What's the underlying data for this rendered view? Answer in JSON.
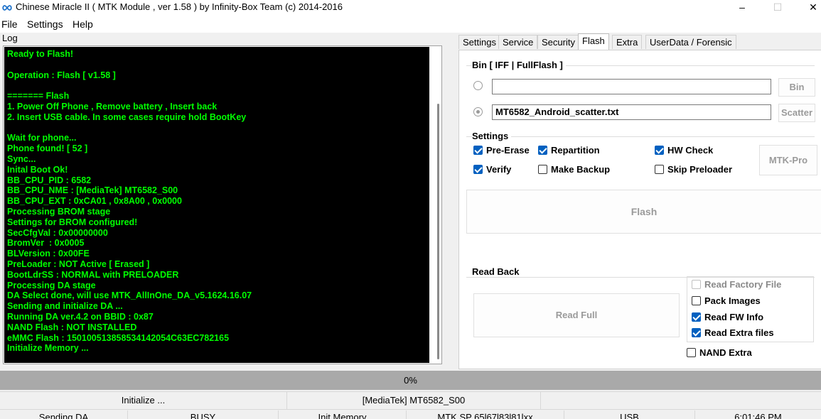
{
  "window": {
    "title": "Chinese Miracle II ( MTK Module , ver 1.58 ) by Infinity-Box Team (c) 2014-2016",
    "minimize": "–",
    "maximize": "☐",
    "close": "✕"
  },
  "menu": {
    "file": "File",
    "settings": "Settings",
    "help": "Help"
  },
  "log": {
    "label": "Log",
    "lines": [
      "Ready to Flash!",
      "",
      "Operation : Flash [ v1.58 ]",
      "",
      "======= Flash",
      "1. Power Off Phone , Remove battery , Insert back",
      "2. Insert USB cable. In some cases require hold BootKey",
      "",
      "Wait for phone...",
      "Phone found! [ 52 ]",
      "Sync...",
      "Inital Boot Ok!",
      "BB_CPU_PID : 6582",
      "BB_CPU_NME : [MediaTek] MT6582_S00",
      "BB_CPU_EXT : 0xCA01 , 0x8A00 , 0x0000",
      "Processing BROM stage",
      "Settings for BROM configured!",
      "SecCfgVal : 0x00000000",
      "BromVer  : 0x0005",
      "BLVersion : 0x00FE",
      "PreLoader : NOT Active [ Erased ]",
      "BootLdrSS : NORMAL with PRELOADER",
      "Processing DA stage",
      "DA Select done, will use MTK_AllInOne_DA_v5.1624.16.07",
      "Sending and initialize DA ...",
      "Running DA ver.4.2 on BBID : 0x87",
      "NAND Flash : NOT INSTALLED",
      "eMMC Flash : 150100513858534142054C63EC782165",
      "Initialize Memory ..."
    ]
  },
  "tabs": [
    "Settings",
    "Service",
    "Security",
    "Flash",
    "Extra",
    "UserData / Forensic"
  ],
  "active_tab": "Flash",
  "flash": {
    "bin_group": "Bin  [ IFF | FullFlash ]",
    "bin_value": "",
    "bin_button": "Bin",
    "scatter_value": "MT6582_Android_scatter.txt",
    "scatter_button": "Scatter",
    "settings_group": "Settings",
    "options": [
      {
        "label": "Pre-Erase",
        "checked": true
      },
      {
        "label": "Repartition",
        "checked": true
      },
      {
        "label": "HW Check",
        "checked": true
      },
      {
        "label": "Verify",
        "checked": true
      },
      {
        "label": "Make Backup",
        "checked": false
      },
      {
        "label": "Skip Preloader",
        "checked": false
      }
    ],
    "mtk_pro_button": "MTK-Pro",
    "flash_button": "Flash",
    "readback_group": "Read Back",
    "read_full_button": "Read Full",
    "readback_options": [
      {
        "label": "Read Factory File",
        "checked": false,
        "disabled": true
      },
      {
        "label": "Pack Images",
        "checked": false,
        "disabled": false
      },
      {
        "label": "Read FW Info",
        "checked": true,
        "disabled": false
      },
      {
        "label": "Read Extra files",
        "checked": true,
        "disabled": false
      }
    ],
    "nand_extra": {
      "label": "NAND Extra",
      "checked": false
    }
  },
  "progress": {
    "text": "0%",
    "percent": 0
  },
  "status_row1": [
    "Initialize ...",
    "[MediaTek] MT6582_S00",
    ""
  ],
  "status_row2": [
    "Sending DA",
    "BUSY",
    "Init Memory",
    "MTK SP 65l67l83l81lxx",
    "USB",
    "6:01:46 PM"
  ],
  "colors": {
    "console_bg": "#000000",
    "console_text": "#00ff00",
    "check_accent": "#0060c0",
    "progress_bg": "#a9a9a9"
  }
}
